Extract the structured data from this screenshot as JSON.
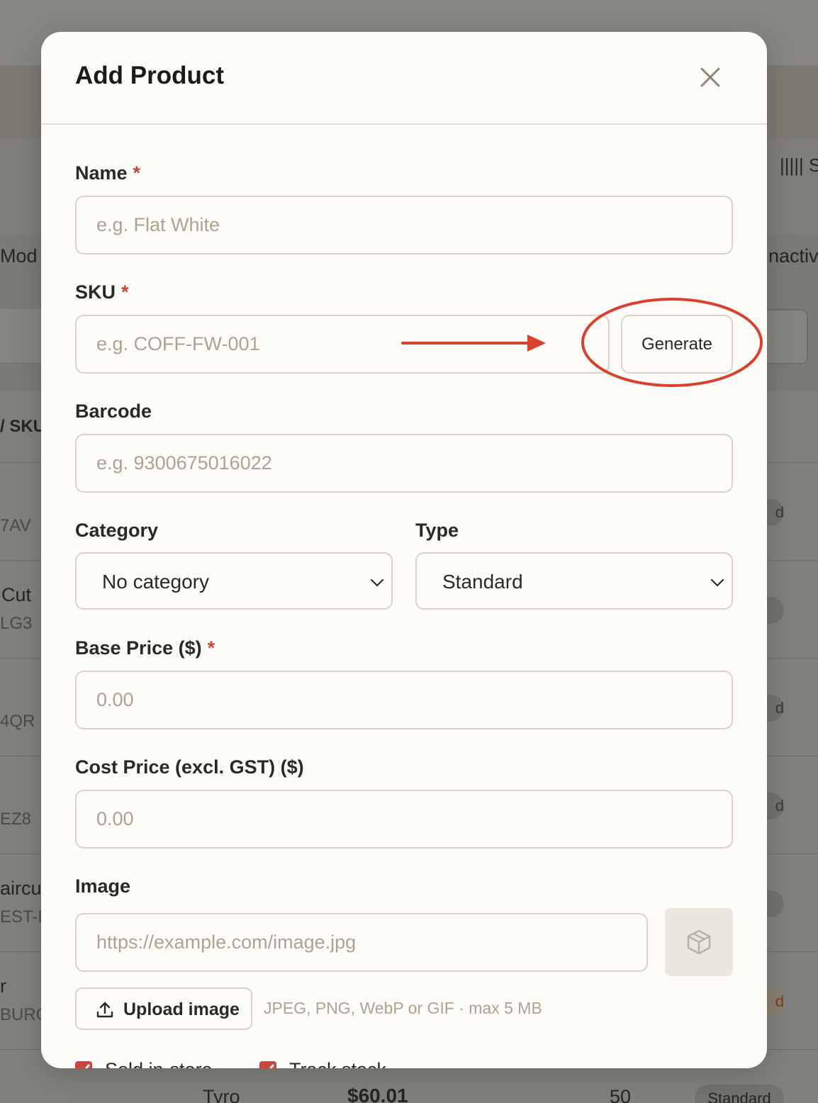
{
  "background": {
    "toolbar_glyph": "||||| S",
    "left_fragments": [
      "Mod",
      "/ SKU",
      "7AV",
      "Cut",
      "LG3",
      "4QR",
      "EZ8",
      "aircu",
      "EST-H",
      "r",
      "BURG"
    ],
    "right_fragments": [
      "nactiv",
      "d",
      "d",
      "d",
      "d"
    ],
    "bottom_row": {
      "processor": "Tyro",
      "price": "$60.01",
      "qty": "50",
      "type": "Standard"
    }
  },
  "modal": {
    "title": "Add Product",
    "close_icon": "close-icon",
    "fields": {
      "name": {
        "label": "Name",
        "required_mark": "*",
        "placeholder": "e.g. Flat White",
        "value": ""
      },
      "sku": {
        "label": "SKU",
        "required_mark": "*",
        "placeholder": "e.g. COFF-FW-001",
        "value": "",
        "generate_label": "Generate"
      },
      "barcode": {
        "label": "Barcode",
        "placeholder": "e.g. 9300675016022",
        "value": ""
      },
      "category": {
        "label": "Category",
        "selected": "No category"
      },
      "type": {
        "label": "Type",
        "selected": "Standard"
      },
      "base_price": {
        "label": "Base Price ($)",
        "required_mark": "*",
        "placeholder": "0.00",
        "value": ""
      },
      "cost_price": {
        "label": "Cost Price (excl. GST) ($)",
        "placeholder": "0.00",
        "value": ""
      },
      "image": {
        "label": "Image",
        "placeholder": "https://example.com/image.jpg",
        "value": "",
        "preview_icon": "box-icon",
        "upload_label": "Upload image",
        "upload_icon": "upload-icon",
        "hint": "JPEG, PNG, WebP or GIF · max 5 MB"
      }
    },
    "checkboxes": [
      {
        "label": "Sold in-store",
        "checked": true
      },
      {
        "label": "Track stock",
        "checked": true
      }
    ]
  },
  "colors": {
    "accent": "#c8473a",
    "annotation": "#d9412f",
    "surface": "#fdfcf8",
    "border": "#d8d4ca"
  }
}
